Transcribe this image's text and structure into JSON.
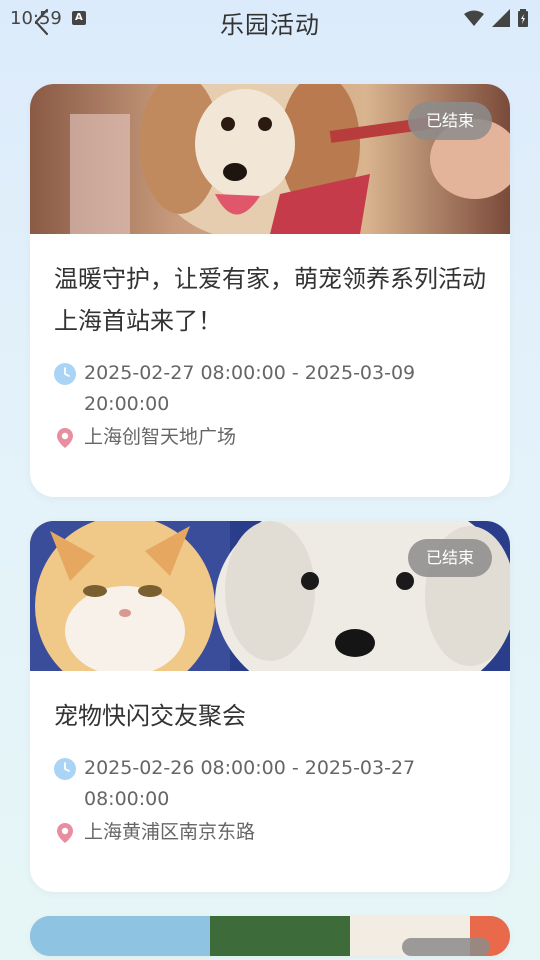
{
  "status_bar": {
    "time": "10:59"
  },
  "header": {
    "title": "乐园活动"
  },
  "events": [
    {
      "title": "温暖守护，让爱有家，萌宠领养系列活动上海首站来了！",
      "status": "已结束",
      "time_range": "2025-02-27 08:00:00 - 2025-03-09 20:00:00",
      "location": "上海创智天地广场"
    },
    {
      "title": "宠物快闪交友聚会",
      "status": "已结束",
      "time_range": "2025-02-26 08:00:00 - 2025-03-27 08:00:00",
      "location": "上海黄浦区南京东路"
    }
  ],
  "colors": {
    "badge_bg": "#8c8c8c",
    "clock_icon": "#a9d4f5",
    "location_icon": "#e78fa0"
  }
}
